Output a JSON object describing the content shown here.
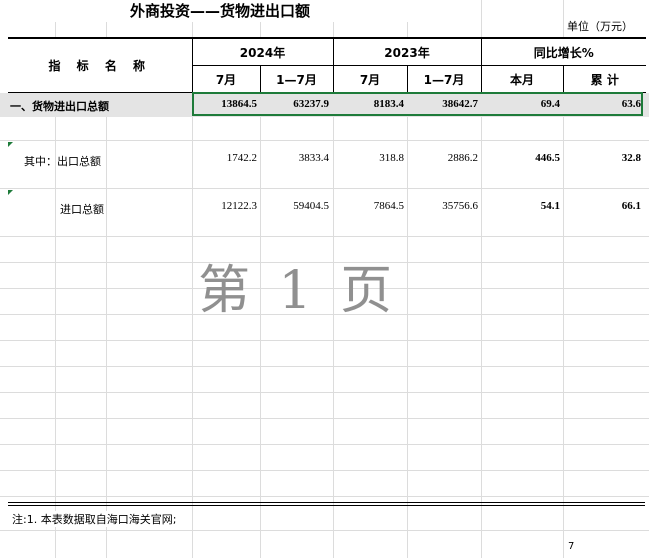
{
  "title": "外商投资——货物进出口额",
  "unit": "单位（万元）",
  "header": {
    "name_col": "指 标 名 称",
    "year_2024": "2024年",
    "year_2023": "2023年",
    "growth": "同比增长%",
    "sub": {
      "july_2024": "7月",
      "jan_jul_2024": "1—7月",
      "july_2023": "7月",
      "jan_jul_2023": "1—7月",
      "this_month": "本月",
      "cumulative": "累 计"
    }
  },
  "rows": [
    {
      "label": "一、货物进出口总额",
      "v": [
        "13864.5",
        "63237.9",
        "8183.4",
        "38642.7",
        "69.4",
        "63.6"
      ]
    },
    {
      "label": "其中：出口总额",
      "v": [
        "1742.2",
        "3833.4",
        "318.8",
        "2886.2",
        "446.5",
        "32.8"
      ]
    },
    {
      "label": "进口总额",
      "v": [
        "12122.3",
        "59404.5",
        "7864.5",
        "35756.6",
        "54.1",
        "66.1"
      ]
    }
  ],
  "watermark": "第 1 页",
  "note": "注:1. 本表数据取自海口海关官网;",
  "page_marker": "7"
}
